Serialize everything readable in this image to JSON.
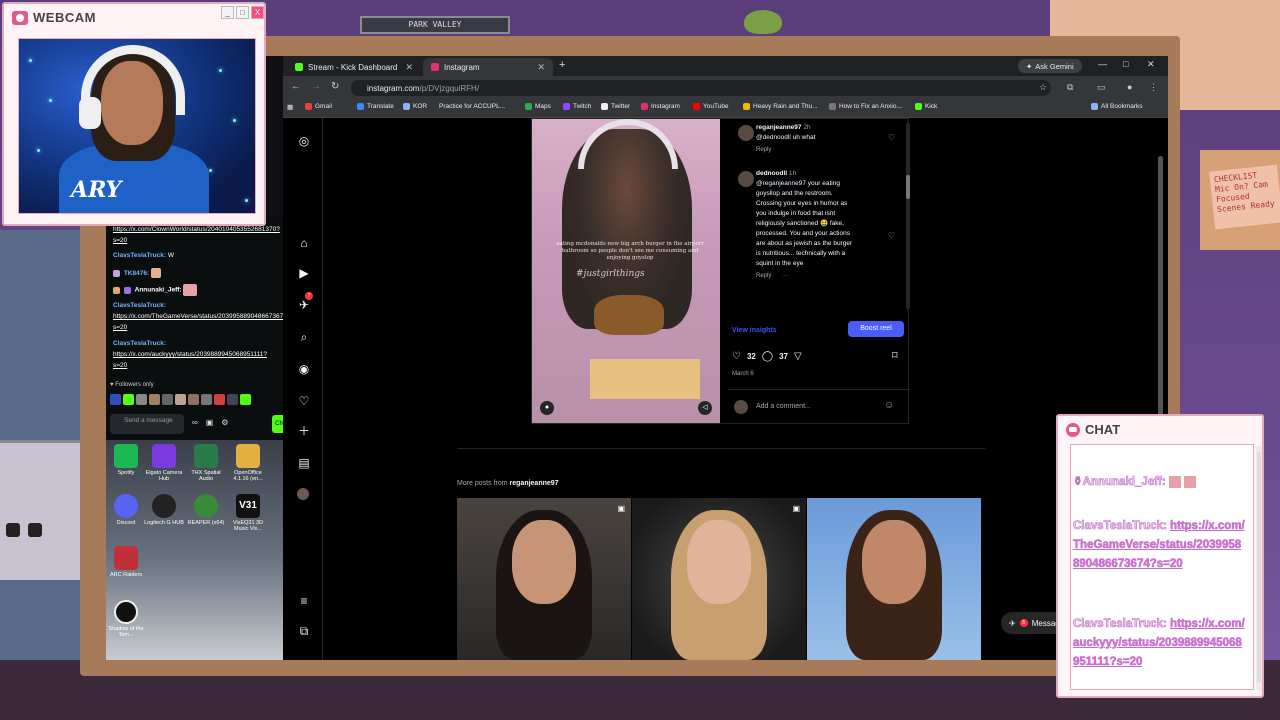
{
  "room": {
    "shelf_label": "PARK VALLEY",
    "note_text": "CHECKLIST Mic On? Cam Focused Scenes Ready"
  },
  "webcam": {
    "title": "WEBCAM",
    "video_text": "ARY",
    "controls": [
      "_",
      "□",
      "X"
    ]
  },
  "chat_overlay": {
    "title": "CHAT",
    "lines": [
      {
        "name": "Annunaki_Jeff:",
        "text": ""
      },
      {
        "name": "ClavsTeslaTruck:",
        "text": "https://x.com/TheGameVerse/status/2039958890486673674?s=20"
      },
      {
        "name": "ClavsTeslaTruck:",
        "text": "https://x.com/auckyyy/status/2039889945068951111?s=20"
      }
    ]
  },
  "browser": {
    "tabs": [
      {
        "label": "Stream - Kick Dashboard",
        "color": "#53fc18"
      },
      {
        "label": "Instagram",
        "color": "#e1306c"
      }
    ],
    "new_tab": "+",
    "ask_gemini": "Ask Gemini",
    "window_controls": [
      "—",
      "□",
      "✕"
    ],
    "url_host": "instagram.com",
    "url_path": "/p/DVjzgquiRFH/",
    "bookmarks": [
      {
        "label": "Gmail",
        "color": "#ea4335"
      },
      {
        "label": "Translate",
        "color": "#4285f4"
      },
      {
        "label": "KOR",
        "color": "#8ab4f8"
      },
      {
        "label": "Practice for ACCUPL...",
        "color": "#777"
      },
      {
        "label": "Maps",
        "color": "#34a853"
      },
      {
        "label": "Twitch",
        "color": "#9146ff"
      },
      {
        "label": "Twitter",
        "color": "#eeeeee"
      },
      {
        "label": "Instagram",
        "color": "#e1306c"
      },
      {
        "label": "YouTube",
        "color": "#ff0000"
      },
      {
        "label": "Heavy Rain and Thu...",
        "color": "#f4b400"
      },
      {
        "label": "How to Fix an Anxio...",
        "color": "#777"
      },
      {
        "label": "Kick",
        "color": "#53fc18"
      }
    ],
    "all_bookmarks": "All Bookmarks"
  },
  "instagram": {
    "post": {
      "caption": "eating mcdonalds new big arch burger in the airport bathroom so people don't see me consuming and enjoying goyslop",
      "hashtag": "#justgirlthings"
    },
    "comments": [
      {
        "user": "reganjeanne97",
        "time": "2h",
        "mention": "@dednoodll",
        "text": "uh what",
        "reply": "Reply"
      },
      {
        "user": "dednoodll",
        "time": "1h",
        "mention": "@reganjeanne97",
        "text": "your eating goysllop and the restroom. Crossing your eyes in humor as you indulge in food that isnt religiously sanctioned 🤮 fake, processed. You and your actions are about as jewish as the burger is nutritious... technically with a squint in the eye",
        "reply": "Reply",
        "more": "···"
      }
    ],
    "view_insights": "View insights",
    "boost": "Boost reel",
    "likes": "32",
    "comments_count": "37",
    "date": "March 6",
    "add_comment_placeholder": "Add a comment...",
    "more_posts_prefix": "More posts from",
    "more_posts_user": "reganjeanne97",
    "messages": "Messages",
    "messages_badge": "5",
    "notif_badge": "7"
  },
  "kick_chat": {
    "messages": [
      {
        "user": "",
        "link": "https://x.com/ClownWorld/status/2040104053552681370?s=20"
      },
      {
        "user": "ClavsTeslaTruck:",
        "text": "W"
      },
      {
        "user": "TK8476:",
        "text": ""
      },
      {
        "user": "Annunaki_Jeff:",
        "text": ""
      },
      {
        "user": "ClavsTeslaTruck:",
        "link": "https://x.com/TheGameVerse/status/2039958890486673674?s=20"
      },
      {
        "user": "ClavsTeslaTruck:",
        "link": "https://x.com/auckyyy/status/2039889945068951111?s=20"
      }
    ],
    "followers_only": "Followers only",
    "input_placeholder": "Send a message",
    "send_label": "Ch"
  },
  "desktop": {
    "icons": [
      {
        "label": "Spotify",
        "color": "#1db954"
      },
      {
        "label": "Elgato Camera Hub",
        "color": "#7a3ae0"
      },
      {
        "label": "THX Spatial Audio",
        "color": "#2a7a4a"
      },
      {
        "label": "OpenOffice 4.1.16 (en...",
        "color": "#e0b040"
      },
      {
        "label": "Discord",
        "color": "#5865f2"
      },
      {
        "label": "Logitech G HUB",
        "color": "#222222"
      },
      {
        "label": "REAPER (x64)",
        "color": "#3a8a3a"
      },
      {
        "label": "VisEQ31 3D Music Vis...",
        "color": "#111111"
      },
      {
        "label": "ARC Raiders",
        "color": "#c0303a"
      },
      {
        "label": "Shadow of the Tom...",
        "color": "#111111"
      }
    ],
    "v31": "V31"
  }
}
